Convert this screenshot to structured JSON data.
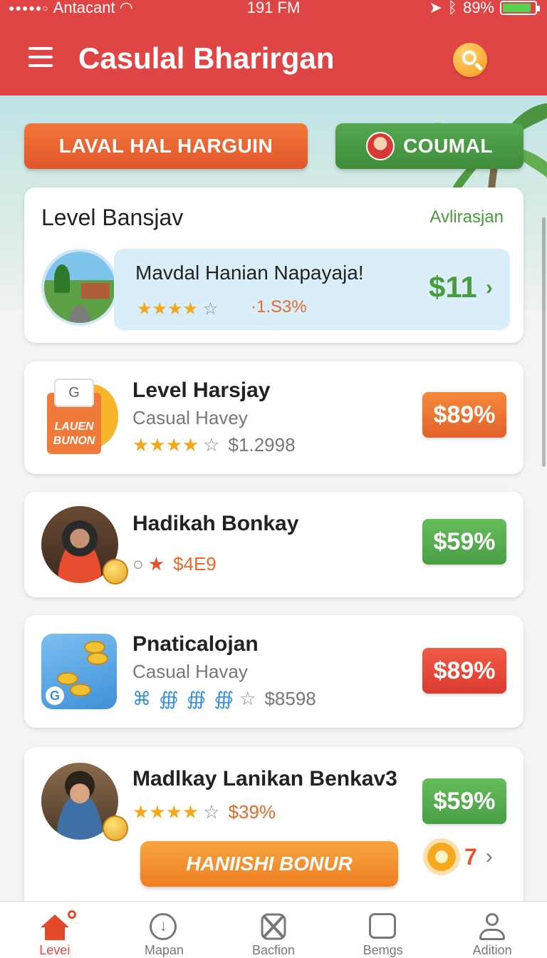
{
  "status_bar": {
    "carrier": "Antacant",
    "time": "191 FM",
    "battery": "89%",
    "battery_level": 0.89
  },
  "header": {
    "title": "Casulal Bharirgan",
    "menu_icon": "hamburger-icon",
    "search_icon": "search-icon"
  },
  "quick_actions": {
    "level_button": "LAVAL HAL HARGUIN",
    "casual_button": "COUMAL"
  },
  "featured": {
    "title": "Level Bansjav",
    "link": "Avlirasjan",
    "item": {
      "name": "Mavdal Hanian Napayaja!",
      "rating": 4,
      "sub": "·1.S3%",
      "price": "$11"
    }
  },
  "list": [
    {
      "title": "Level Harsjay",
      "subtitle": "Casual Havey",
      "rating": 4,
      "value": "$1.2998",
      "badge": "$89%",
      "badge_color": "orange",
      "icon_tab": "G",
      "icon_text_1": "LAUEN",
      "icon_text_2": "BUNON"
    },
    {
      "title": "Hadikah Bonkay",
      "value": "$4E9",
      "badge": "$59%",
      "badge_color": "green"
    },
    {
      "title": "Pnaticalojan",
      "subtitle": "Casual Havay",
      "value": "$8598",
      "badge": "$89%",
      "badge_color": "red",
      "rating_marks": "⌘ ∰ ∰ ∰"
    },
    {
      "title": "Madlkay Lanikan Benkav3",
      "rating": 4,
      "value": "$39%",
      "badge": "$59%",
      "badge_color": "green",
      "action_button": "HANIISHI BONUR",
      "streak_count": "7"
    }
  ],
  "bottom_nav": [
    {
      "label": "Levei",
      "icon": "home-icon",
      "active": true
    },
    {
      "label": "Mapan",
      "icon": "download-icon",
      "active": false
    },
    {
      "label": "Bacfion",
      "icon": "tools-icon",
      "active": false
    },
    {
      "label": "Bemgs",
      "icon": "card-icon",
      "active": false
    },
    {
      "label": "Adition",
      "icon": "user-icon",
      "active": false
    }
  ],
  "colors": {
    "header": "#e04545",
    "accent_green": "#4a9a3e",
    "accent_orange": "#ee7f22"
  }
}
